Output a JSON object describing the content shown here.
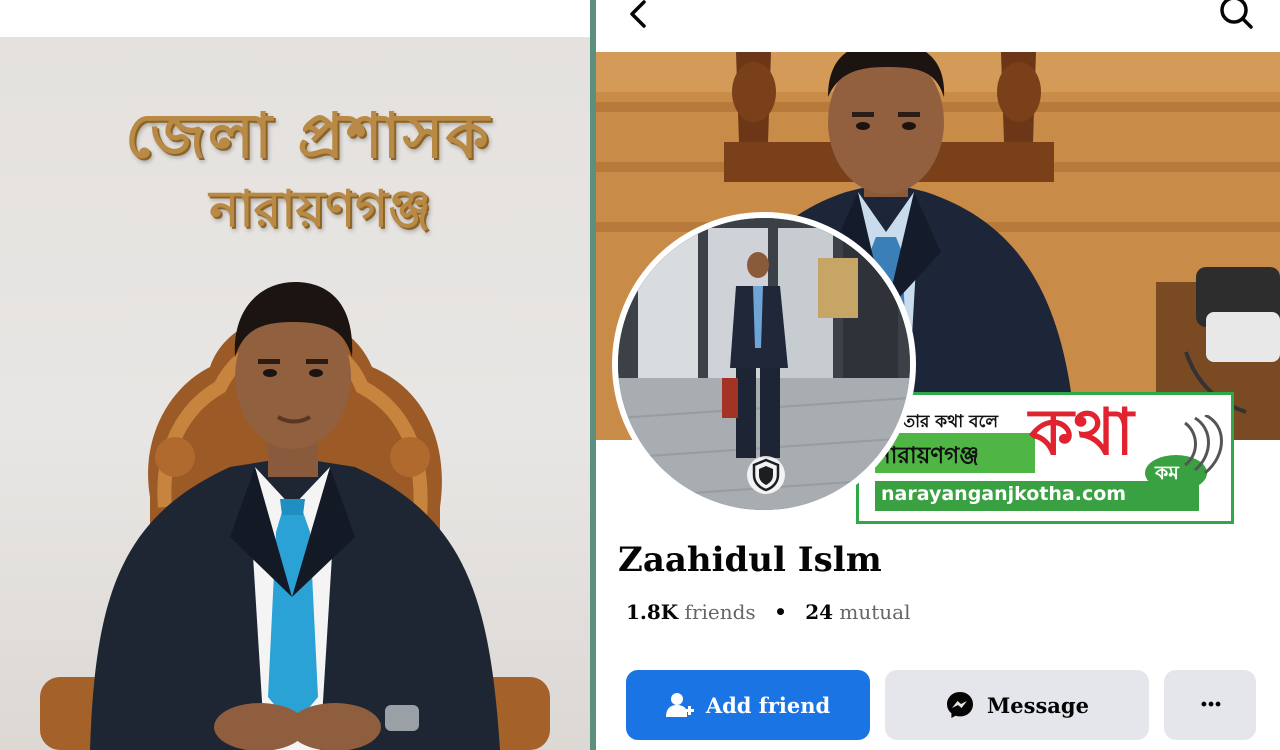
{
  "left_photo": {
    "sign_line_1": "জেলা প্রশাসক",
    "sign_line_2": "নারায়ণগঞ্জ"
  },
  "topbar": {
    "back_icon": "chevron-left-icon",
    "search_icon": "search-icon"
  },
  "profile": {
    "name": "Zaahidul Islm",
    "friends_count": "1.8K",
    "friends_label": "friends",
    "mutual_count": "24",
    "mutual_label": "mutual",
    "separator": "•",
    "avatar_badge_icon": "shield-icon"
  },
  "actions": {
    "add_friend_label": "Add friend",
    "add_friend_icon": "add-person-icon",
    "message_label": "Message",
    "message_icon": "messenger-icon",
    "more_label": "···",
    "more_icon": "more-dots-icon"
  },
  "watermark": {
    "tagline": "জনতার কথা বলে",
    "place": "নারায়ণগঞ্জ",
    "brand": "কথা",
    "com_label": "কম",
    "url": "narayanganjkotha.com"
  },
  "colors": {
    "primary_blue": "#1b74e4",
    "button_gray": "#e4e6eb",
    "divider_green": "#5c8f7d",
    "watermark_green": "#3aa142",
    "watermark_red": "#e0232e"
  }
}
